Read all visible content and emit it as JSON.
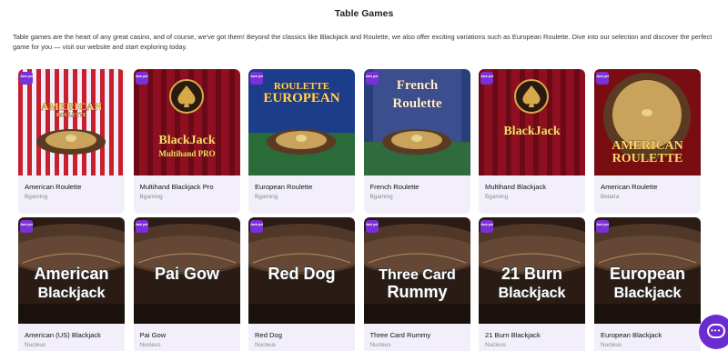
{
  "page": {
    "title": "Table Games",
    "intro": "Table games are the heart of any great casino, and of course, we've got them! Beyond the classics like Blackjack and Roulette, we also offer exciting variations such as European Roulette. Dive into our selection and discover the perfect game for you — visit our website and start exploring today."
  },
  "badge_text": "Jack pot",
  "games": [
    {
      "name": "American Roulette",
      "provider": "Bgaming",
      "art": [
        "AMERICAN",
        "ROULETTE"
      ],
      "theme": "american-roulette",
      "icon": "roulette-wheel"
    },
    {
      "name": "Multihand Blackjack Pro",
      "provider": "Bgaming",
      "art": [
        "BlackJack",
        "Multihand PRO"
      ],
      "theme": "blackjack-gold",
      "icon": "spade-emblem"
    },
    {
      "name": "European Roulette",
      "provider": "Bgaming",
      "art": [
        "ROULETTE",
        "EUROPEAN"
      ],
      "theme": "european-roulette",
      "icon": "roulette-wheel"
    },
    {
      "name": "French Roulette",
      "provider": "Bgaming",
      "art": [
        "French",
        "Roulette"
      ],
      "theme": "french-roulette",
      "icon": "roulette-wheel"
    },
    {
      "name": "Multihand Blackjack",
      "provider": "Bgaming",
      "art": [
        "BlackJack",
        ""
      ],
      "theme": "blackjack-red",
      "icon": "spade-emblem"
    },
    {
      "name": "American Roulette",
      "provider": "Belatra",
      "art": [
        "AMERICAN",
        "ROULETTE"
      ],
      "theme": "belatra-roulette",
      "icon": "roulette-wheel"
    },
    {
      "name": "American (US) Blackjack",
      "provider": "Nucleus",
      "art": [
        "American",
        "Blackjack"
      ],
      "theme": "nucleus",
      "icon": "card-table"
    },
    {
      "name": "Pai Gow",
      "provider": "Nucleus",
      "art": [
        "Pai Gow",
        ""
      ],
      "theme": "nucleus",
      "icon": "card-table"
    },
    {
      "name": "Red Dog",
      "provider": "Nucleus",
      "art": [
        "Red Dog",
        ""
      ],
      "theme": "nucleus",
      "icon": "card-table"
    },
    {
      "name": "Three Card Rummy",
      "provider": "Nucleus",
      "art": [
        "Three Card",
        "Rummy"
      ],
      "theme": "nucleus",
      "icon": "card-table"
    },
    {
      "name": "21 Burn Blackjack",
      "provider": "Nucleus",
      "art": [
        "21 Burn",
        "Blackjack"
      ],
      "theme": "nucleus",
      "icon": "card-table"
    },
    {
      "name": "European Blackjack",
      "provider": "Nucleus",
      "art": [
        "European",
        "Blackjack"
      ],
      "theme": "nucleus",
      "icon": "card-table"
    }
  ],
  "colors": {
    "accent": "#7b2fd6",
    "card_bg": "#f2effa",
    "provider_text": "#8a8a8a"
  },
  "chat": {
    "icon": "chat-bubble-icon"
  }
}
